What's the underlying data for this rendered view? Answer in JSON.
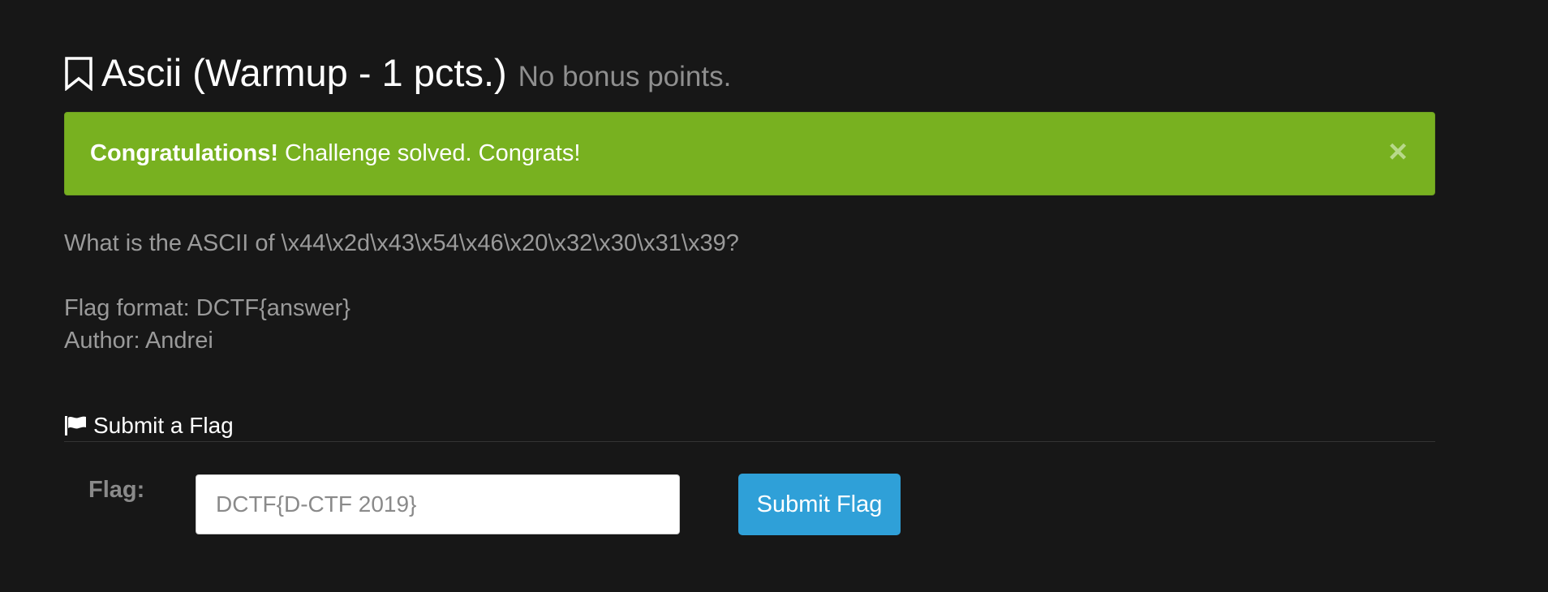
{
  "header": {
    "title": "Ascii (Warmup - 1 pcts.)",
    "subtitle": "No bonus points.",
    "icon": "bookmark-icon"
  },
  "alert": {
    "strong": "Congratulations!",
    "message": " Challenge solved. Congrats!",
    "close_label": "×",
    "color": "#78b120"
  },
  "description": {
    "question": "What is the ASCII of \\x44\\x2d\\x43\\x54\\x46\\x20\\x32\\x30\\x31\\x39?",
    "format": "Flag format: DCTF{answer}",
    "author": "Author: Andrei"
  },
  "submit": {
    "header_label": "Submit a Flag",
    "header_icon": "flag-icon",
    "flag_label": "Flag:",
    "input_placeholder": "DCTF{D-CTF 2019}",
    "input_value": "",
    "button_label": "Submit Flag",
    "button_color": "#2fa0d8"
  }
}
